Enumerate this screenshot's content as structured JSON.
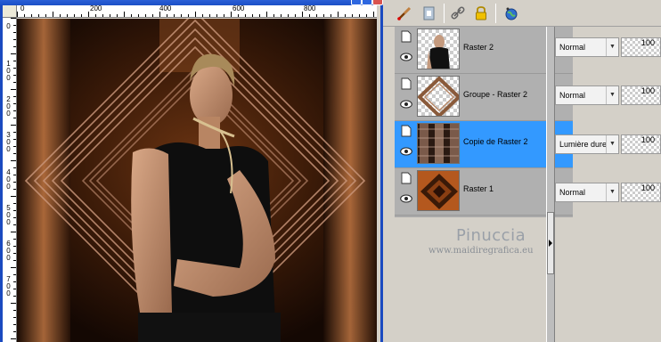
{
  "canvas_window": {
    "title": "",
    "ruler_top": [
      "0",
      "200",
      "400",
      "600",
      "800"
    ],
    "ruler_left": [
      "0",
      "100",
      "200",
      "300",
      "400",
      "500",
      "600",
      "700"
    ]
  },
  "toolbar": {
    "icons": [
      "brush-icon",
      "layer-mask-icon",
      "link-icon",
      "lock-icon",
      "globe-icon"
    ]
  },
  "layers": [
    {
      "name": "Raster 2",
      "blend": "Normal",
      "opacity": "100",
      "selected": false,
      "thumb": "portrait-icon"
    },
    {
      "name": "Groupe - Raster 2",
      "blend": "Normal",
      "opacity": "100",
      "selected": false,
      "thumb": "diamond-frame-icon"
    },
    {
      "name": "Copie de Raster 2",
      "blend": "Lumière dure",
      "opacity": "100",
      "selected": true,
      "thumb": "stripes-icon"
    },
    {
      "name": "Raster 1",
      "blend": "Normal",
      "opacity": "100",
      "selected": false,
      "thumb": "brown-diamond-icon"
    }
  ],
  "watermark": {
    "name": "Pinuccia",
    "url": "www.maidiregrafica.eu"
  },
  "colors": {
    "selection": "#3399ff",
    "panel": "#d4d0c8",
    "brown_dark": "#2a1408",
    "brown_light": "#c86a2e"
  }
}
